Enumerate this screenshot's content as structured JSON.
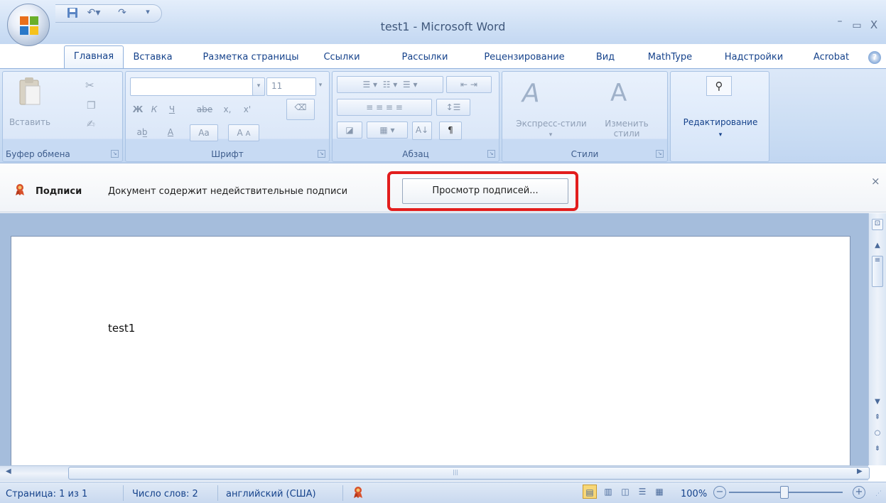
{
  "window": {
    "title": "test1 - Microsoft Word",
    "controls": {
      "minimize": "–",
      "restore": "▭",
      "close": "X"
    }
  },
  "quick_access": {
    "save_icon": "save-icon",
    "undo_icon": "undo-icon",
    "redo_icon": "redo-icon",
    "customize": "▾"
  },
  "tabs": [
    {
      "label": "Главная",
      "active": true
    },
    {
      "label": "Вставка"
    },
    {
      "label": "Разметка страницы"
    },
    {
      "label": "Ссылки"
    },
    {
      "label": "Рассылки"
    },
    {
      "label": "Рецензирование"
    },
    {
      "label": "Вид"
    },
    {
      "label": "MathType"
    },
    {
      "label": "Надстройки"
    },
    {
      "label": "Acrobat"
    }
  ],
  "help_label": "?",
  "ribbon": {
    "clipboard": {
      "label": "Буфер обмена",
      "paste": "Вставить"
    },
    "font": {
      "label": "Шрифт",
      "font_name": "",
      "font_size": "11",
      "bold": "Ж",
      "italic": "К",
      "underline": "Ч",
      "strike": "abe",
      "subscript": "x,",
      "superscript": "x'",
      "case": "Aa",
      "grow": "A",
      "shrink": "A"
    },
    "paragraph": {
      "label": "Абзац",
      "pilcrow": "¶"
    },
    "styles": {
      "label": "Стили",
      "express": "Экспресс-стили",
      "change": "Изменить стили"
    },
    "editing": {
      "label": "Редактирование"
    }
  },
  "signature_bar": {
    "title": "Подписи",
    "message": "Документ содержит недействительные подписи",
    "button": "Просмотр подписей...",
    "close": "×"
  },
  "document": {
    "text": "test1"
  },
  "hscroll_center": "|||",
  "status": {
    "page": "Страница: 1 из 1",
    "words": "Число слов: 2",
    "language": "английский (США)",
    "zoom": "100%",
    "zoom_out": "−",
    "zoom_in": "+"
  },
  "colors": {
    "highlight": "#e21d1d",
    "ribbon": "#c9dcf3",
    "text": "#15428b"
  }
}
